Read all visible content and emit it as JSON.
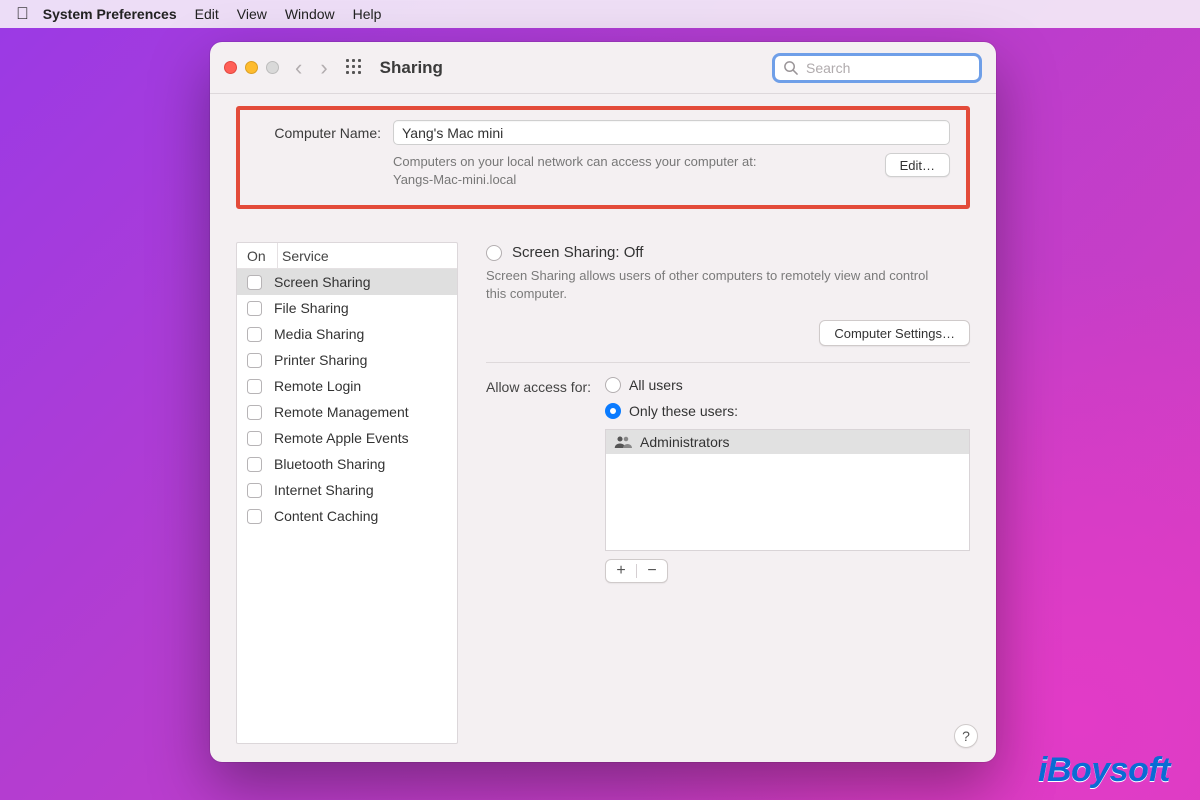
{
  "menubar": {
    "app": "System Preferences",
    "items": [
      "Edit",
      "View",
      "Window",
      "Help"
    ]
  },
  "window": {
    "title": "Sharing",
    "search_placeholder": "Search"
  },
  "computer_name": {
    "label": "Computer Name:",
    "value": "Yang's Mac mini",
    "hint_line1": "Computers on your local network can access your computer at:",
    "hint_line2": "Yangs-Mac-mini.local",
    "edit_label": "Edit…"
  },
  "service_table": {
    "col_on": "On",
    "col_service": "Service",
    "items": [
      {
        "label": "Screen Sharing",
        "on": false,
        "selected": true
      },
      {
        "label": "File Sharing",
        "on": false,
        "selected": false
      },
      {
        "label": "Media Sharing",
        "on": false,
        "selected": false
      },
      {
        "label": "Printer Sharing",
        "on": false,
        "selected": false
      },
      {
        "label": "Remote Login",
        "on": false,
        "selected": false
      },
      {
        "label": "Remote Management",
        "on": false,
        "selected": false
      },
      {
        "label": "Remote Apple Events",
        "on": false,
        "selected": false
      },
      {
        "label": "Bluetooth Sharing",
        "on": false,
        "selected": false
      },
      {
        "label": "Internet Sharing",
        "on": false,
        "selected": false
      },
      {
        "label": "Content Caching",
        "on": false,
        "selected": false
      }
    ]
  },
  "detail": {
    "status_title": "Screen Sharing: Off",
    "description": "Screen Sharing allows users of other computers to remotely view and control this computer.",
    "computer_settings_label": "Computer Settings…",
    "allow_access_label": "Allow access for:",
    "option_all": "All users",
    "option_only": "Only these users:",
    "selected_option": "only",
    "users": [
      "Administrators"
    ],
    "add_label": "+",
    "remove_label": "−",
    "help_label": "?"
  },
  "watermark": "iBoysoft"
}
